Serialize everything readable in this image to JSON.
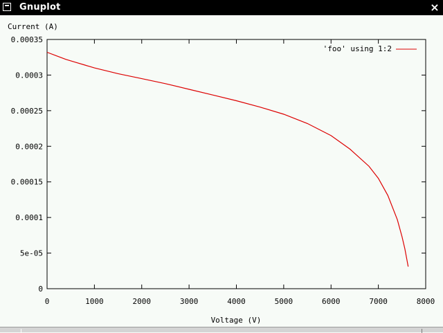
{
  "window": {
    "title": "Gnuplot",
    "close_symbol": "×",
    "icons": {
      "menu": "window-menu-icon",
      "close": "close-icon"
    }
  },
  "colors": {
    "series": "#dd0000",
    "background": "#f7fbf7",
    "titlebar": "#000000"
  },
  "chart_data": {
    "type": "line",
    "title": "",
    "xlabel": "Voltage (V)",
    "ylabel": "Current (A)",
    "xlim": [
      0,
      8000
    ],
    "ylim": [
      0,
      0.00035
    ],
    "xticks": [
      "0",
      "1000",
      "2000",
      "3000",
      "4000",
      "5000",
      "6000",
      "7000",
      "8000"
    ],
    "yticks": [
      "0",
      "5e-05",
      "0.0001",
      "0.00015",
      "0.0002",
      "0.00025",
      "0.0003",
      "0.00035"
    ],
    "grid": false,
    "legend_position": "top-right",
    "series": [
      {
        "name": "'foo' using 1:2",
        "color": "#dd0000",
        "x": [
          0,
          200,
          400,
          600,
          800,
          1000,
          1500,
          2000,
          2500,
          3000,
          3500,
          4000,
          4500,
          5000,
          5500,
          6000,
          6400,
          6800,
          7000,
          7200,
          7400,
          7500,
          7560,
          7600,
          7630
        ],
        "y": [
          0.000332,
          0.000327,
          0.000322,
          0.000318,
          0.000314,
          0.00031,
          0.000302,
          0.000295,
          0.000288,
          0.00028,
          0.000272,
          0.000264,
          0.000255,
          0.000245,
          0.000232,
          0.000215,
          0.000196,
          0.000172,
          0.000155,
          0.000131,
          9.7e-05,
          7.3e-05,
          5.6e-05,
          4.2e-05,
          3.1e-05
        ]
      }
    ]
  }
}
